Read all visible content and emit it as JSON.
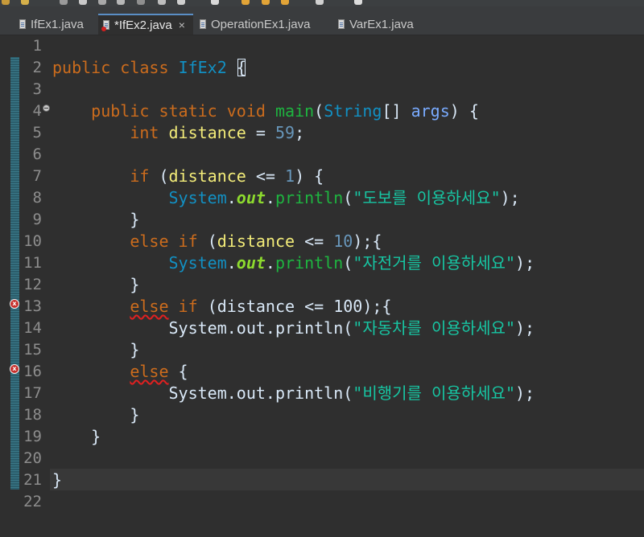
{
  "colors": {
    "keyword": "#cc6c1d",
    "type": "#1290c3",
    "method": "#1eb540",
    "static_field": "#8dda2e",
    "number": "#6897bb",
    "string": "#17c6a3",
    "local_variable": "#f3ec79",
    "parameter": "#79abff",
    "error": "#c6302c",
    "active_tab_accent": "#5a8ec5"
  },
  "tabs": [
    {
      "label": "IfEx1.java",
      "icon": "java-file-icon",
      "active": false
    },
    {
      "label": "*IfEx2.java",
      "icon": "java-file-error-icon",
      "active": true,
      "close": "×"
    },
    {
      "label": "OperationEx1.java",
      "icon": "java-file-icon",
      "active": false
    },
    {
      "label": "VarEx1.java",
      "icon": "java-file-icon",
      "active": false
    }
  ],
  "editor": {
    "line_numbers": [
      "1",
      "2",
      "3",
      "4",
      "5",
      "6",
      "7",
      "8",
      "9",
      "10",
      "11",
      "12",
      "13",
      "14",
      "15",
      "16",
      "17",
      "18",
      "19",
      "20",
      "21",
      "22"
    ],
    "error_lines": [
      "13",
      "16"
    ],
    "error_marker_glyph": "x",
    "current_line": "21",
    "lines": {
      "l2": {
        "kw1": "public",
        "kw2": "class",
        "cls": "IfEx2",
        "brace": "{"
      },
      "l4": {
        "kw1": "public",
        "kw2": "static",
        "kw3": "void",
        "fn": "main",
        "p1": "(",
        "type": "String",
        "p2": "[]",
        "param": "args",
        "p3": ")",
        "brace": "{"
      },
      "l5": {
        "kw": "int",
        "var": "distance",
        "op": "=",
        "num": "59",
        "semi": ";"
      },
      "l7": {
        "kw": "if",
        "p1": "(",
        "var": "distance",
        "op": "<=",
        "num": "1",
        "p2": ")",
        "brace": "{"
      },
      "l8": {
        "cls": "System",
        "dot1": ".",
        "fld": "out",
        "dot2": ".",
        "fn": "println",
        "p1": "(",
        "str": "\"도보를 이용하세요\"",
        "p2": ");"
      },
      "l9": {
        "brace": "}"
      },
      "l10": {
        "kw1": "else",
        "kw2": "if",
        "p1": "(",
        "var": "distance",
        "op": "<=",
        "num": "10",
        "p2": ");{"
      },
      "l11": {
        "cls": "System",
        "dot1": ".",
        "fld": "out",
        "dot2": ".",
        "fn": "println",
        "p1": "(",
        "str": "\"자전거를 이용하세요\"",
        "p2": ");"
      },
      "l12": {
        "brace": "}"
      },
      "l13": {
        "kw1": "else",
        "kw2": "if",
        "rest": "(distance <= 100);{"
      },
      "l14": {
        "plain": "System.out.println(",
        "str": "\"자동차를 이용하세요\"",
        "p2": ");"
      },
      "l15": {
        "brace": "}"
      },
      "l16": {
        "kw": "else",
        "brace": "{"
      },
      "l17": {
        "plain": "System.out.println(",
        "str": "\"비행기를 이용하세요\"",
        "p2": ");"
      },
      "l18": {
        "brace": "}"
      },
      "l19": {
        "brace": "}"
      },
      "l21": {
        "brace": "}"
      }
    }
  }
}
